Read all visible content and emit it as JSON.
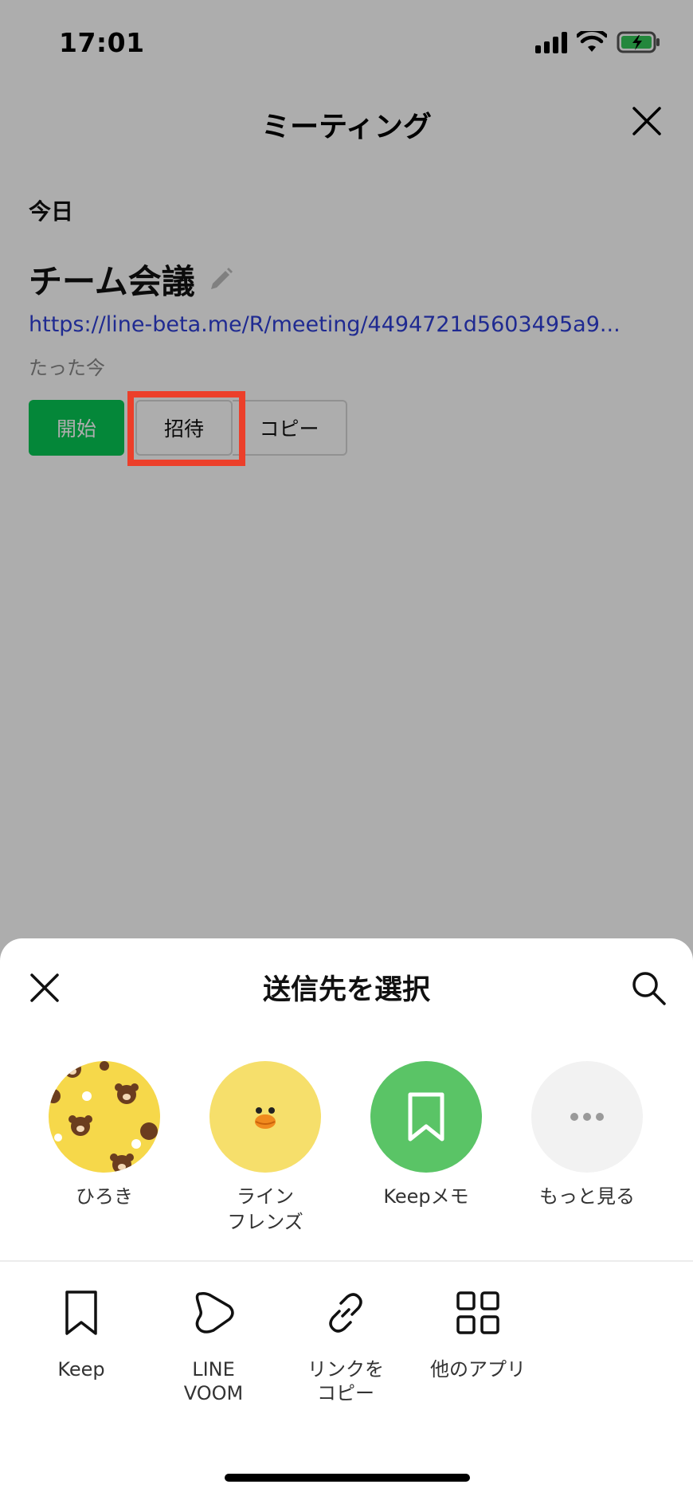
{
  "status": {
    "time": "17:01"
  },
  "nav": {
    "title": "ミーティング"
  },
  "meeting": {
    "date_label": "今日",
    "name": "チーム会議",
    "url": "https://line-beta.me/R/meeting/4494721d5603495a9...",
    "time_ago": "たった今",
    "start_label": "開始",
    "invite_label": "招待",
    "copy_label": "コピー"
  },
  "sheet": {
    "title": "送信先を選択",
    "friends": [
      {
        "name": "ひろき"
      },
      {
        "name_line1": "ライン",
        "name_line2": "フレンズ"
      },
      {
        "name": "Keepメモ"
      },
      {
        "name": "もっと見る"
      }
    ],
    "apps": [
      {
        "label": "Keep",
        "icon": "bookmark-icon"
      },
      {
        "label_line1": "LINE",
        "label_line2": "VOOM",
        "icon": "voom-icon"
      },
      {
        "label_line1": "リンクを",
        "label_line2": "コピー",
        "icon": "link-icon"
      },
      {
        "label": "他のアプリ",
        "icon": "grid-icon"
      }
    ]
  },
  "colors": {
    "accent_green": "#06c755",
    "highlight_red": "#ec3f2a",
    "link_blue": "#2f3fd6",
    "keep_green": "#5ac466",
    "brown_bg_yellow": "#f6d84a"
  }
}
